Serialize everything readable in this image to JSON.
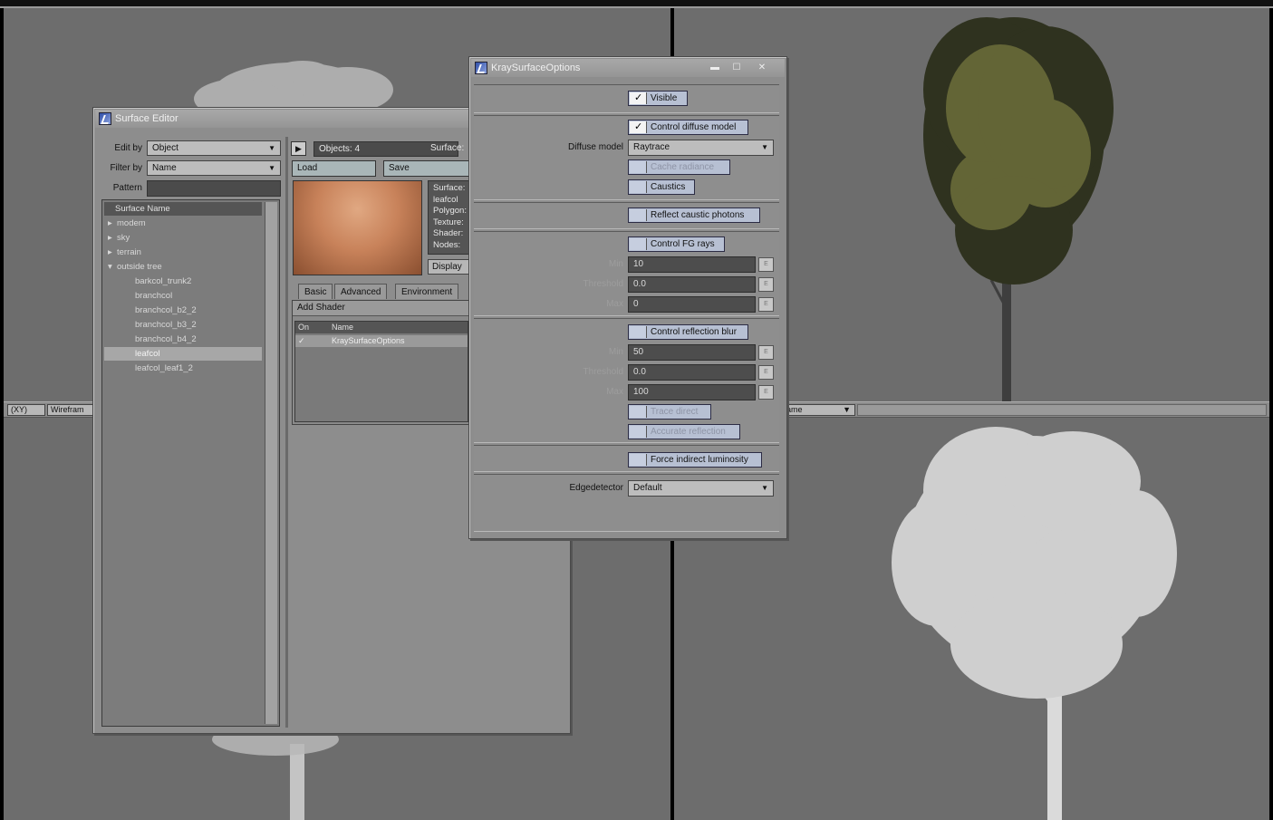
{
  "viewports": {
    "left_header": {
      "view_menu": "(XY)",
      "shading_menu": "Wirefram"
    },
    "right_header": {
      "shading_menu": "ame"
    }
  },
  "surface_editor": {
    "title": "Surface Editor",
    "edit_by_label": "Edit by",
    "edit_by_value": "Object",
    "filter_by_label": "Filter by",
    "filter_by_value": "Name",
    "pattern_label": "Pattern",
    "pattern_value": "",
    "list_header": "Surface Name",
    "surfaces": [
      {
        "label": "modem",
        "indent": 0,
        "expander": "▸"
      },
      {
        "label": "sky",
        "indent": 0,
        "expander": "▸"
      },
      {
        "label": "terrain",
        "indent": 0,
        "expander": "▸"
      },
      {
        "label": "outside tree",
        "indent": 0,
        "expander": "▾"
      },
      {
        "label": "barkcol_trunk2",
        "indent": 1,
        "expander": ""
      },
      {
        "label": "branchcol",
        "indent": 1,
        "expander": ""
      },
      {
        "label": "branchcol_b2_2",
        "indent": 1,
        "expander": ""
      },
      {
        "label": "branchcol_b3_2",
        "indent": 1,
        "expander": ""
      },
      {
        "label": "branchcol_b4_2",
        "indent": 1,
        "expander": ""
      },
      {
        "label": "leafcol",
        "indent": 1,
        "expander": "",
        "selected": true
      },
      {
        "label": "leafcol_leaf1_2",
        "indent": 1,
        "expander": ""
      }
    ],
    "objects_label": "Objects: 4",
    "surface_col_label": "Surface:",
    "load_label": "Load",
    "save_label": "Save",
    "info_lines": [
      "Surface:",
      "leafcol",
      "Polygon:",
      "Texture:",
      "Shader:",
      "Nodes:"
    ],
    "display_label": "Display",
    "tabs": [
      "Basic",
      "Advanced",
      "Environment"
    ],
    "add_shader_label": "Add Shader",
    "shader_headers": {
      "on": "On",
      "name": "Name"
    },
    "shaders": [
      {
        "on": "✓",
        "name": "KraySurfaceOptions"
      }
    ],
    "preview_color": "#c8825a"
  },
  "kray_dialog": {
    "title": "KraySurfaceOptions",
    "controls": {
      "minimize": "▬",
      "maximize": "☐",
      "close": "✕"
    },
    "visible": {
      "label": "Visible",
      "checked": true
    },
    "control_diffuse": {
      "label": "Control diffuse model",
      "checked": true
    },
    "diffuse_model_label": "Diffuse model",
    "diffuse_model_value": "Raytrace",
    "cache_radiance": {
      "label": "Cache radiance",
      "checked": false,
      "disabled": true
    },
    "caustics": {
      "label": "Caustics",
      "checked": false
    },
    "reflect_caustic": {
      "label": "Reflect caustic photons",
      "checked": false
    },
    "control_fg": {
      "label": "Control FG rays",
      "checked": false
    },
    "fg_min_label": "Min",
    "fg_min_value": "10",
    "fg_threshold_label": "Threshold",
    "fg_threshold_value": "0.0",
    "fg_max_label": "Max",
    "fg_max_value": "0",
    "control_blur": {
      "label": "Control reflection blur",
      "checked": false
    },
    "blur_min_label": "Min",
    "blur_min_value": "50",
    "blur_threshold_label": "Threshold",
    "blur_threshold_value": "0.0",
    "blur_max_label": "Max",
    "blur_max_value": "100",
    "trace_direct": {
      "label": "Trace direct",
      "checked": false,
      "disabled": true
    },
    "accurate_reflection": {
      "label": "Accurate reflection",
      "checked": false,
      "disabled": true
    },
    "force_indirect": {
      "label": "Force indirect luminosity",
      "checked": false
    },
    "edgedetector_label": "Edgedetector",
    "edgedetector_value": "Default",
    "env_label": "E"
  }
}
